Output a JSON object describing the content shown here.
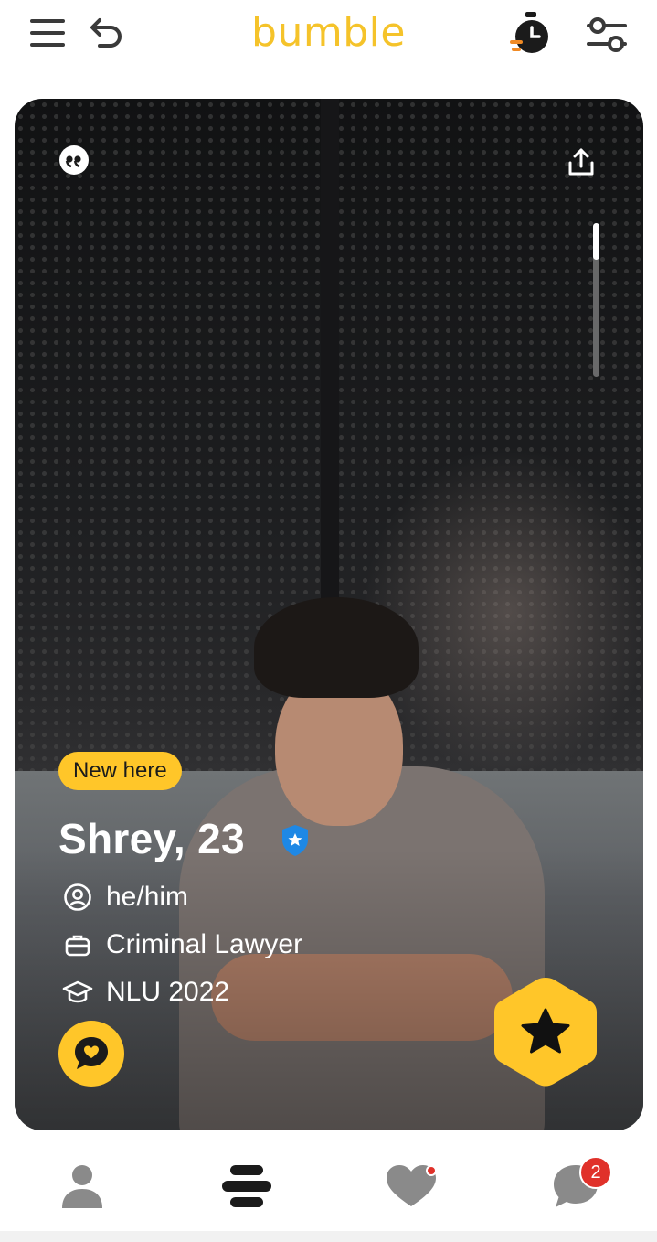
{
  "app": {
    "brand": "bumble",
    "brand_color": "#F5C32A"
  },
  "header": {
    "menu_icon": "hamburger-menu-icon",
    "undo_icon": "undo-icon",
    "timer_icon": "stopwatch-icon",
    "filter_icon": "filter-sliders-icon"
  },
  "profile": {
    "badge": "New here",
    "name_age": "Shrey, 23",
    "verified_icon": "verified-shield-icon",
    "details": [
      {
        "icon": "person-circle-icon",
        "text": "he/him"
      },
      {
        "icon": "briefcase-icon",
        "text": "Criminal Lawyer"
      },
      {
        "icon": "graduation-cap-icon",
        "text": "NLU 2022"
      }
    ],
    "photo_scroll_progress": 0.24
  },
  "card_actions": {
    "quote_icon": "quote-icon",
    "share_icon": "share-icon",
    "compliment_icon": "compliment-heart-bubble-icon",
    "superswipe_icon": "star-icon"
  },
  "bottom_nav": {
    "items": [
      {
        "name": "profile",
        "icon": "person-icon"
      },
      {
        "name": "discover",
        "icon": "bumble-stack-icon"
      },
      {
        "name": "likes",
        "icon": "heart-icon"
      },
      {
        "name": "chats",
        "icon": "chat-bubble-icon"
      }
    ],
    "chats_badge": "2"
  },
  "colors": {
    "accent_yellow": "#FFC629",
    "verified_blue": "#1E88E5",
    "notification_red": "#E0312A"
  }
}
